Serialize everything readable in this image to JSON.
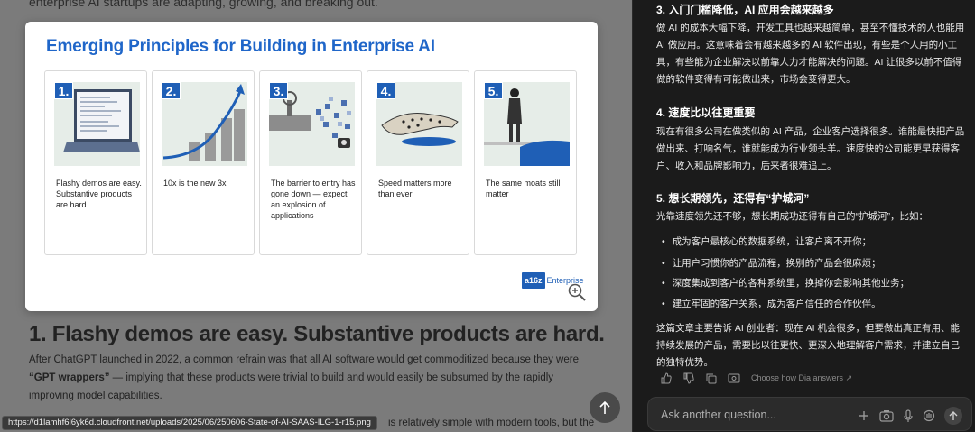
{
  "article": {
    "intro_fragment": "enterprise AI startups are adapting, growing, and breaking out.",
    "image": {
      "title": "Emerging Principles for Building in Enterprise AI",
      "cards": [
        {
          "num": "1.",
          "caption": "Flashy demos are easy. Substantive products are hard."
        },
        {
          "num": "2.",
          "caption": "10x is the new 3x"
        },
        {
          "num": "3.",
          "caption": "The barrier to entry has gone down — expect an explosion of applications"
        },
        {
          "num": "4.",
          "caption": "Speed matters more than ever"
        },
        {
          "num": "5.",
          "caption": "The same moats still matter"
        }
      ],
      "brand_logo": "a16z",
      "brand_text": "Enterprise"
    },
    "heading": "1. Flashy demos are easy. Substantive products are hard.",
    "para_a": "After ChatGPT launched in 2022, a common refrain was that all AI software would get commoditized because they were ",
    "para_bold": "“GPT wrappers”",
    "para_b": " — implying that these products were trivial to build and would easily be subsumed by the rapidly improving model capabilities.",
    "para_tail": "is relatively simple with modern tools, but the",
    "status_url": "https://d1lamhf6l6yk6d.cloudfront.net/uploads/2025/06/250606-State-of-AI-SAAS-ILG-1-r15.png"
  },
  "chat": {
    "h3": "3. 入门门槛降低，AI 应用会越来越多",
    "p3": "做 AI 的成本大幅下降，开发工具也越来越简单，甚至不懂技术的人也能用 AI 做应用。这意味着会有越来越多的 AI 软件出现，有些是个人用的小工具，有些能为企业解决以前靠人力才能解决的问题。AI 让很多以前不值得做的软件变得有可能做出来，市场会变得更大。",
    "h4": "4. 速度比以往更重要",
    "p4": "现在有很多公司在做类似的 AI 产品，企业客户选择很多。谁能最快把产品做出来、打响名气，谁就能成为行业领头羊。速度快的公司能更早获得客户、收入和品牌影响力，后来者很难追上。",
    "h5": "5. 想长期领先，还得有“护城河”",
    "p5": "光靠速度领先还不够，想长期成功还得有自己的“护城河”，比如：",
    "bullets": [
      "成为客户最核心的数据系统，让客户离不开你；",
      "让用户习惯你的产品流程，换别的产品会很麻烦；",
      "深度集成到客户的各种系统里，换掉你会影响其他业务；",
      "建立牢固的客户关系，成为客户信任的合作伙伴。"
    ],
    "summary": "这篇文章主要告诉 AI 创业者：现在 AI 机会很多，但要做出真正有用、能持续发展的产品，需要比以往更快、更深入地理解客户需求，并建立自己的独特优势。",
    "choose_label": "Choose how Dia answers ↗",
    "input_placeholder": "Ask another question..."
  }
}
